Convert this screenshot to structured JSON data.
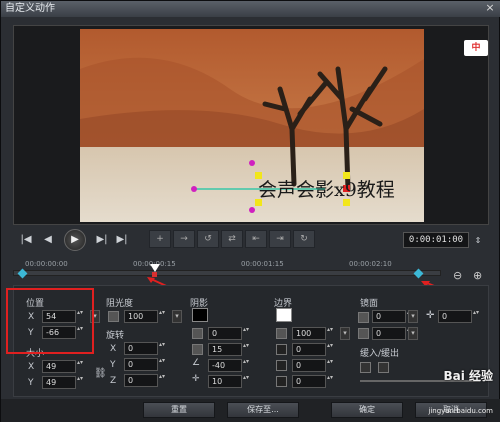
{
  "window": {
    "title": "自定义动作",
    "close": "×"
  },
  "preview": {
    "overlay_text": "会声会影x9教程",
    "logo_text": "中"
  },
  "transport": {
    "timecode": "0:00:01:00",
    "buttons": [
      "I◀",
      "◀",
      "▶",
      "▶I",
      "▶I"
    ]
  },
  "ruler": {
    "ticks": [
      "00:00:00:00",
      "00:00:00:15",
      "00:00:01:15",
      "00:00:02:10"
    ]
  },
  "position": {
    "title": "位置",
    "x_label": "X",
    "x_value": "54",
    "y_label": "Y",
    "y_value": "-66"
  },
  "size": {
    "title": "大小",
    "x_label": "X",
    "x_value": "49",
    "y_label": "Y",
    "y_value": "49"
  },
  "opacity": {
    "title": "阻光度",
    "value": "100"
  },
  "rotation": {
    "title": "旋转",
    "x_label": "X",
    "x_value": "0",
    "y_label": "Y",
    "y_value": "0",
    "z_label": "Z",
    "z_value": "0"
  },
  "shadow": {
    "title": "阴影",
    "color": "#000000",
    "v1": "0",
    "v2": "15",
    "v3": "-40",
    "v4": "10"
  },
  "border": {
    "title": "边界",
    "color": "#ffffff",
    "v1": "100",
    "v2": "0",
    "v3": "0",
    "v4": "0"
  },
  "mirror": {
    "title": "镜面",
    "v1": "0",
    "v2": "0",
    "v3": "0"
  },
  "fade": {
    "title": "缓入/缓出"
  },
  "buttons": {
    "reset": "重置",
    "save": "保存至...",
    "ok": "确定",
    "cancel": "取消"
  },
  "watermark": {
    "brand": "Bai 经验",
    "url": "jingyan.baidu.com"
  },
  "colors": {
    "highlight": "#e02020",
    "keyframe": "#3cb8d6"
  }
}
